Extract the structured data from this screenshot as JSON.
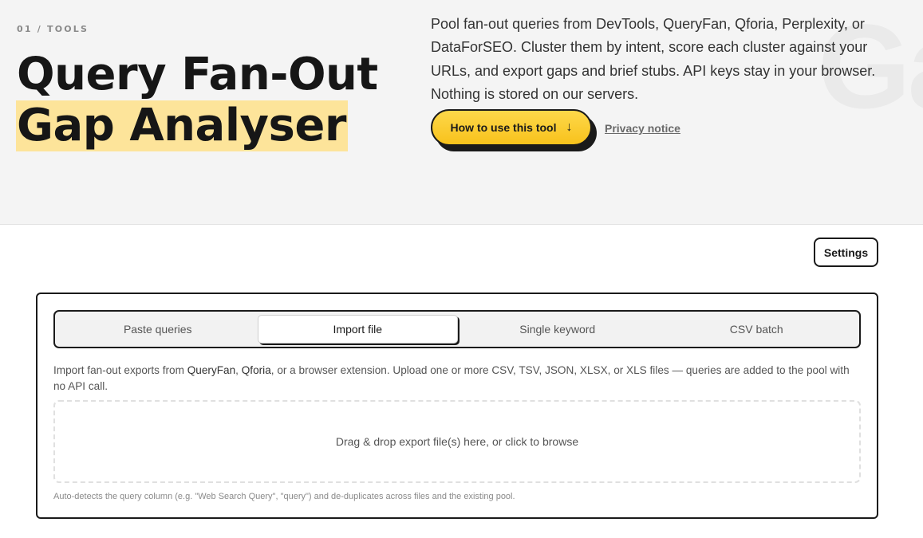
{
  "hero": {
    "eyebrow": "01 / TOOLS",
    "title_line1": "Query Fan-Out",
    "title_line2": "Gap Analyser",
    "background_mark": "Ga",
    "description": "Pool fan-out queries from DevTools, QueryFan, Qforia, Perplexity, or DataForSEO. Cluster them by intent, score each cluster against your URLs, and export gaps and brief stubs. API keys stay in your browser. Nothing is stored on our servers.",
    "cta_label": "How to use this tool",
    "cta_icon": "arrow-down-icon",
    "cta_arrow": "↓",
    "privacy_link": "Privacy notice"
  },
  "toolbar": {
    "settings_label": "Settings"
  },
  "panel": {
    "tabs": [
      {
        "label": "Paste queries",
        "active": false
      },
      {
        "label": "Import file",
        "active": true
      },
      {
        "label": "Single keyword",
        "active": false
      },
      {
        "label": "CSV batch",
        "active": false
      }
    ],
    "intro_prefix": "Import fan-out exports from ",
    "intro_brand1": "QueryFan",
    "intro_sep": ", ",
    "intro_brand2": "Qforia",
    "intro_suffix": ", or a browser extension. Upload one or more CSV, TSV, JSON, XLSX, or XLS files — queries are added to the pool with no API call.",
    "dropzone_text": "Drag & drop export file(s) here, or click to browse",
    "hint": "Auto-detects the query column (e.g. \"Web Search Query\", \"query\") and de-duplicates across files and the existing pool."
  },
  "colors": {
    "accent_yellow": "#f8c21c",
    "highlight": "#fde49a",
    "ink": "#1a1a1a",
    "hero_bg": "#f4f4f4"
  }
}
